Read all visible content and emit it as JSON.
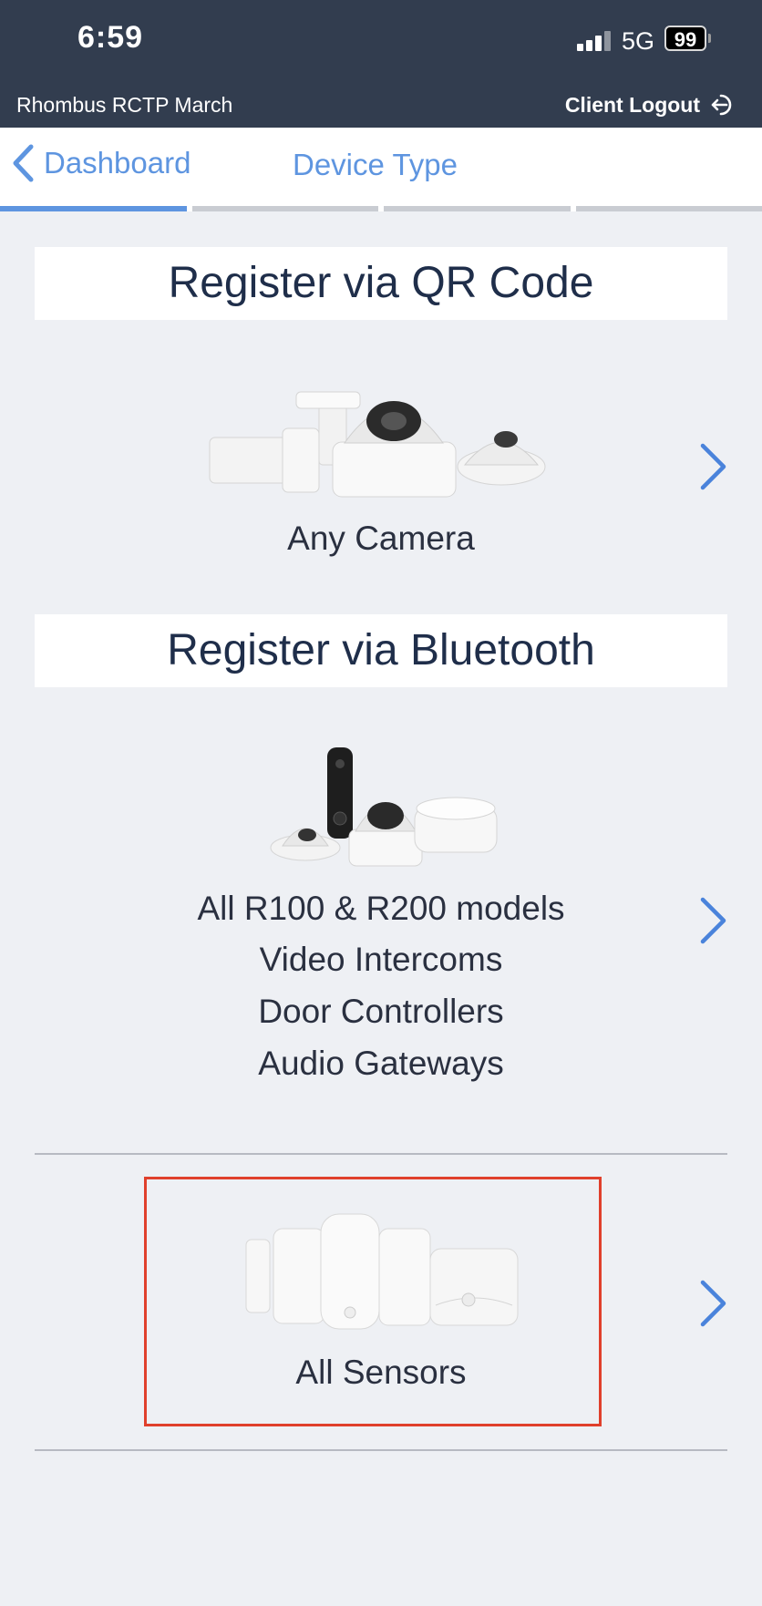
{
  "status_bar": {
    "time": "6:59",
    "network": "5G",
    "battery": "99"
  },
  "header": {
    "org_name": "Rhombus RCTP March",
    "logout_label": "Client Logout"
  },
  "nav": {
    "back_label": "Dashboard",
    "title": "Device Type",
    "progress_steps": 4,
    "progress_current": 1,
    "accent": "#5e95e0"
  },
  "sections": {
    "qr": {
      "title": "Register via QR Code",
      "label": "Any Camera"
    },
    "bluetooth": {
      "title": "Register via Bluetooth",
      "lines": [
        "All R100 & R200 models",
        "Video Intercoms",
        "Door Controllers",
        "Audio Gateways"
      ]
    },
    "sensors": {
      "label": "All Sensors"
    }
  },
  "icons": [
    "chevron-left-icon",
    "logout-icon",
    "chevron-right-icon"
  ]
}
